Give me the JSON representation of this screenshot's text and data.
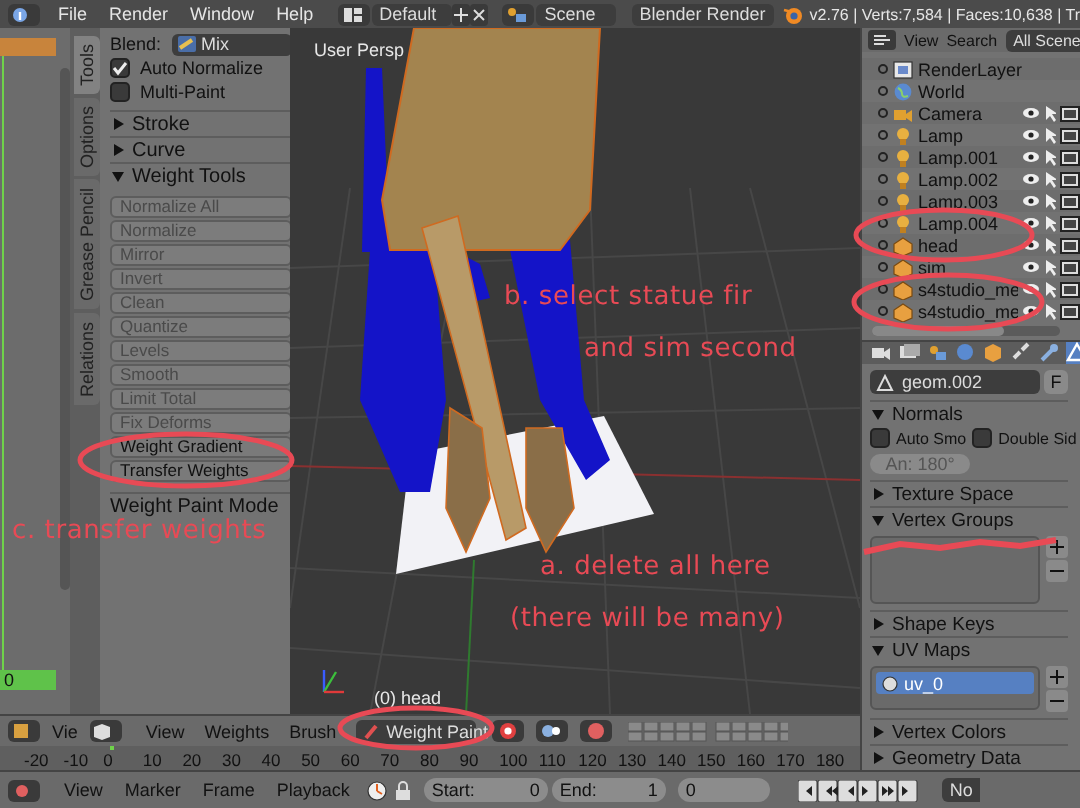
{
  "top_bar": {
    "menus": [
      "File",
      "Render",
      "Window",
      "Help"
    ],
    "layout": "Default",
    "scene": "Scene",
    "engine": "Blender Render",
    "stats": "v2.76 | Verts:7,584 | Faces:10,638 | Tr"
  },
  "frame_indicator": "0",
  "tool_shelf": {
    "tabs": [
      {
        "label": "Tools",
        "selected": true
      },
      {
        "label": "Options",
        "selected": false
      },
      {
        "label": "Grease Pencil",
        "selected": false
      },
      {
        "label": "Relations",
        "selected": false
      }
    ],
    "blend_label": "Blend:",
    "blend_value": "Mix",
    "options": [
      {
        "label": "Auto Normalize",
        "checked": true
      },
      {
        "label": "Multi-Paint",
        "checked": false
      }
    ],
    "panels": [
      {
        "title": "Stroke",
        "expanded": false
      },
      {
        "title": "Curve",
        "expanded": false
      },
      {
        "title": "Weight Tools",
        "expanded": true,
        "buttons": [
          {
            "label": "Normalize All",
            "disabled": true
          },
          {
            "label": "Normalize",
            "disabled": true
          },
          {
            "label": "Mirror",
            "disabled": true
          },
          {
            "label": "Invert",
            "disabled": true
          },
          {
            "label": "Clean",
            "disabled": true
          },
          {
            "label": "Quantize",
            "disabled": true
          },
          {
            "label": "Levels",
            "disabled": true
          },
          {
            "label": "Smooth",
            "disabled": true
          },
          {
            "label": "Limit Total",
            "disabled": true
          },
          {
            "label": "Fix Deforms",
            "disabled": true
          },
          {
            "label": "Weight Gradient",
            "disabled": false
          },
          {
            "label": "Transfer Weights",
            "disabled": false
          }
        ]
      }
    ],
    "mode_panel": "Weight Paint Mode"
  },
  "viewport": {
    "view_name": "User Persp",
    "object_label": "(0) head"
  },
  "view3d_header": {
    "left_menu": "Vie",
    "menus": [
      "View",
      "Weights",
      "Brush"
    ],
    "mode": "Weight Paint"
  },
  "ruler": [
    "-20",
    "-10",
    "0",
    "10",
    "20",
    "30",
    "40",
    "50",
    "60",
    "70",
    "80",
    "90",
    "100",
    "110",
    "120",
    "130",
    "140",
    "150",
    "160",
    "170",
    "180"
  ],
  "timeline_header": {
    "menus": [
      "View",
      "Marker",
      "Frame",
      "Playback"
    ],
    "start_label": "Start:",
    "start": "0",
    "end_label": "End:",
    "end": "1",
    "current": "0",
    "sync": "No"
  },
  "outliner": {
    "menus": [
      "View",
      "Search"
    ],
    "scope": "All Scene",
    "items": [
      {
        "name": "RenderLayer",
        "kind": "renderlayer"
      },
      {
        "name": "World",
        "kind": "world"
      },
      {
        "name": "Camera",
        "kind": "camera"
      },
      {
        "name": "Lamp",
        "kind": "lamp"
      },
      {
        "name": "Lamp.001",
        "kind": "lamp"
      },
      {
        "name": "Lamp.002",
        "kind": "lamp"
      },
      {
        "name": "Lamp.003",
        "kind": "lamp"
      },
      {
        "name": "Lamp.004",
        "kind": "lamp"
      },
      {
        "name": "head",
        "kind": "mesh"
      },
      {
        "name": "sim",
        "kind": "mesh"
      },
      {
        "name": "s4studio_me",
        "kind": "mesh"
      },
      {
        "name": "s4studio_me",
        "kind": "mesh"
      }
    ]
  },
  "properties": {
    "datablock": "geom.002",
    "fake_user": "F",
    "panels": [
      {
        "title": "Normals",
        "expanded": true,
        "kind": "normals",
        "checks": [
          {
            "label": "Auto Smo",
            "checked": false
          },
          {
            "label": "Double Sid",
            "checked": false
          }
        ],
        "angle": "An: 180°"
      },
      {
        "title": "Texture Space",
        "expanded": false
      },
      {
        "title": "Vertex Groups",
        "expanded": true,
        "kind": "list"
      },
      {
        "title": "Shape Keys",
        "expanded": false
      },
      {
        "title": "UV Maps",
        "expanded": true,
        "kind": "list",
        "items": [
          {
            "name": "uv_0",
            "selected": true
          }
        ]
      },
      {
        "title": "Vertex Colors",
        "expanded": false
      },
      {
        "title": "Geometry Data",
        "expanded": false
      }
    ]
  },
  "annotations": [
    {
      "text": "b. select statue fir"
    },
    {
      "text": "and sim second"
    },
    {
      "text": "c. transfer weights"
    },
    {
      "text": "a. delete all here"
    },
    {
      "text": "(there will be many)"
    }
  ]
}
